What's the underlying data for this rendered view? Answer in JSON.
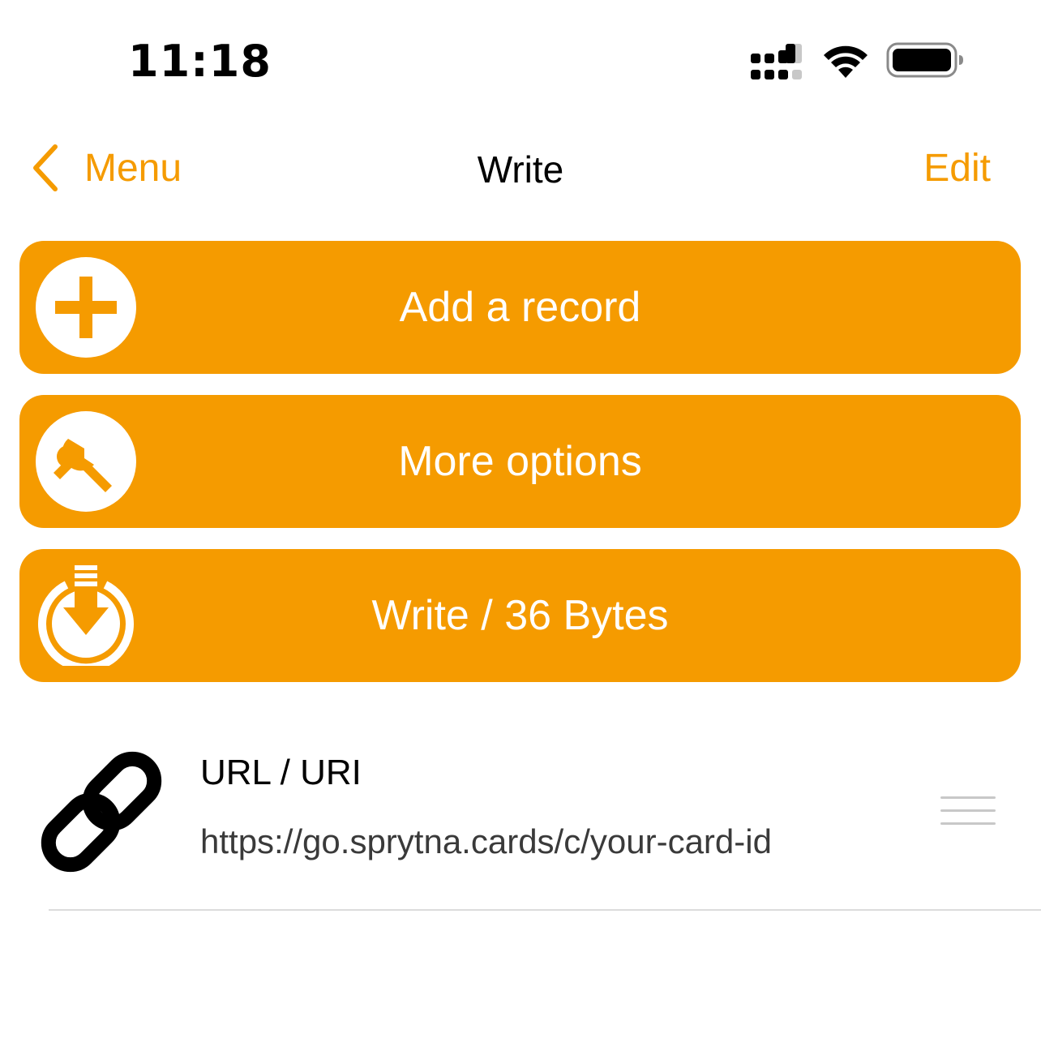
{
  "status_bar": {
    "time": "11:18",
    "icons": [
      "cellular-signal-icon",
      "wifi-icon",
      "battery-icon"
    ]
  },
  "nav": {
    "back_label": "Menu",
    "title": "Write",
    "edit_label": "Edit"
  },
  "actions": [
    {
      "label": "Add a record",
      "icon": "plus-circle-icon"
    },
    {
      "label": "More options",
      "icon": "wrench-circle-icon"
    },
    {
      "label": "Write / 36 Bytes",
      "icon": "download-circle-icon"
    }
  ],
  "records": [
    {
      "type": "URL / URI",
      "value": "https://go.sprytna.cards/c/your-card-id",
      "icon": "link-icon"
    }
  ],
  "colors": {
    "accent": "#f59b00",
    "background": "#ffffff",
    "text": "#000000",
    "secondary_text": "#3a3a3a"
  }
}
